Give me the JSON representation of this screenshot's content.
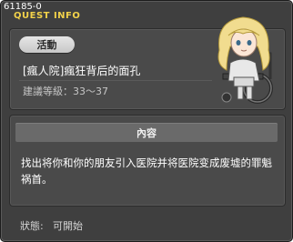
{
  "window": {
    "quest_id": "61185-0",
    "title": "QUEST INFO"
  },
  "top": {
    "badge": "活動",
    "quest_name": "[瘋人院]瘋狂背后的面孔",
    "level": "建議等級：33～37"
  },
  "content": {
    "header": "內容",
    "description": "找出将你和你的朋友引入医院并将医院变成废墟的罪魁祸首。"
  },
  "status": {
    "label": "狀態:",
    "value": "可開始"
  },
  "colors": {
    "title": "#f2d24a",
    "window_bg": "#3f3f3f",
    "panel_bg": "#4a4a4a"
  },
  "icons": {
    "npc": "npc-portrait-icon"
  }
}
